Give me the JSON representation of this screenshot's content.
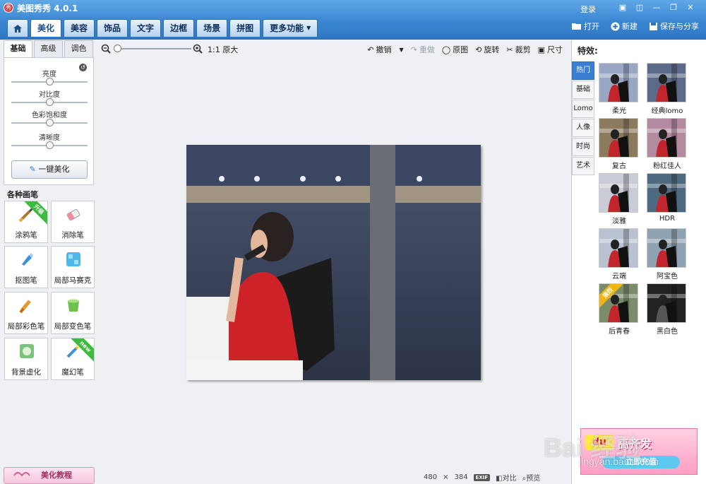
{
  "app": {
    "title": "美图秀秀 4.0.1",
    "login": "登录"
  },
  "main_tabs": [
    "美化",
    "美容",
    "饰品",
    "文字",
    "边框",
    "场景",
    "拼图"
  ],
  "more_tab": "更多功能",
  "top_actions": {
    "open": "打开",
    "new": "新建",
    "save": "保存与分享"
  },
  "adjust": {
    "tabs": [
      "基础",
      "高级",
      "调色"
    ],
    "sliders": [
      {
        "label": "亮度",
        "value": 0.5
      },
      {
        "label": "对比度",
        "value": 0.5
      },
      {
        "label": "色彩饱和度",
        "value": 0.5
      },
      {
        "label": "清晰度",
        "value": 0.5
      }
    ],
    "one_key": "一键美化"
  },
  "brushes": {
    "heading": "各种画笔",
    "items": [
      {
        "label": "涂鸦笔",
        "ribbon": "升级"
      },
      {
        "label": "消除笔",
        "ribbon": ""
      },
      {
        "label": "抠图笔",
        "ribbon": ""
      },
      {
        "label": "局部马赛克",
        "ribbon": ""
      },
      {
        "label": "局部彩色笔",
        "ribbon": ""
      },
      {
        "label": "局部变色笔",
        "ribbon": ""
      },
      {
        "label": "背景虚化",
        "ribbon": ""
      },
      {
        "label": "魔幻笔",
        "ribbon": "new"
      }
    ]
  },
  "tutorial": "美化教程",
  "toolbar": {
    "zoom_level": 0,
    "original_size": "1:1 原大",
    "undo": "撤销",
    "redo": "重做",
    "restore": "原图",
    "rotate": "旋转",
    "crop": "裁剪",
    "resize": "尺寸"
  },
  "status": {
    "width": "480",
    "times": "×",
    "height": "384",
    "exif": "EXIF",
    "compare": "对比",
    "preview": "预览"
  },
  "effects": {
    "title": "特效:",
    "categories": [
      "热门",
      "基础",
      "Lomo",
      "人像",
      "时尚",
      "艺术"
    ],
    "items": [
      {
        "label": "柔光"
      },
      {
        "label": "经典lomo"
      },
      {
        "label": "复古"
      },
      {
        "label": "粉红佳人"
      },
      {
        "label": "淡雅"
      },
      {
        "label": "HDR"
      },
      {
        "label": "云端"
      },
      {
        "label": "阿宝色"
      },
      {
        "label": "后青春"
      },
      {
        "label": "黑白色"
      }
    ],
    "ribbon": "强烈"
  },
  "ad": {
    "logo": "du",
    "text": "高齐发",
    "button": "立即充值"
  },
  "watermark": {
    "main": "Bai 经验",
    "sub": "jingyan.baidu.com"
  },
  "colors": {
    "accent": "#3a7fd5",
    "title_bar": "#3b86d2",
    "ribbon_green": "#3dbb3d"
  }
}
